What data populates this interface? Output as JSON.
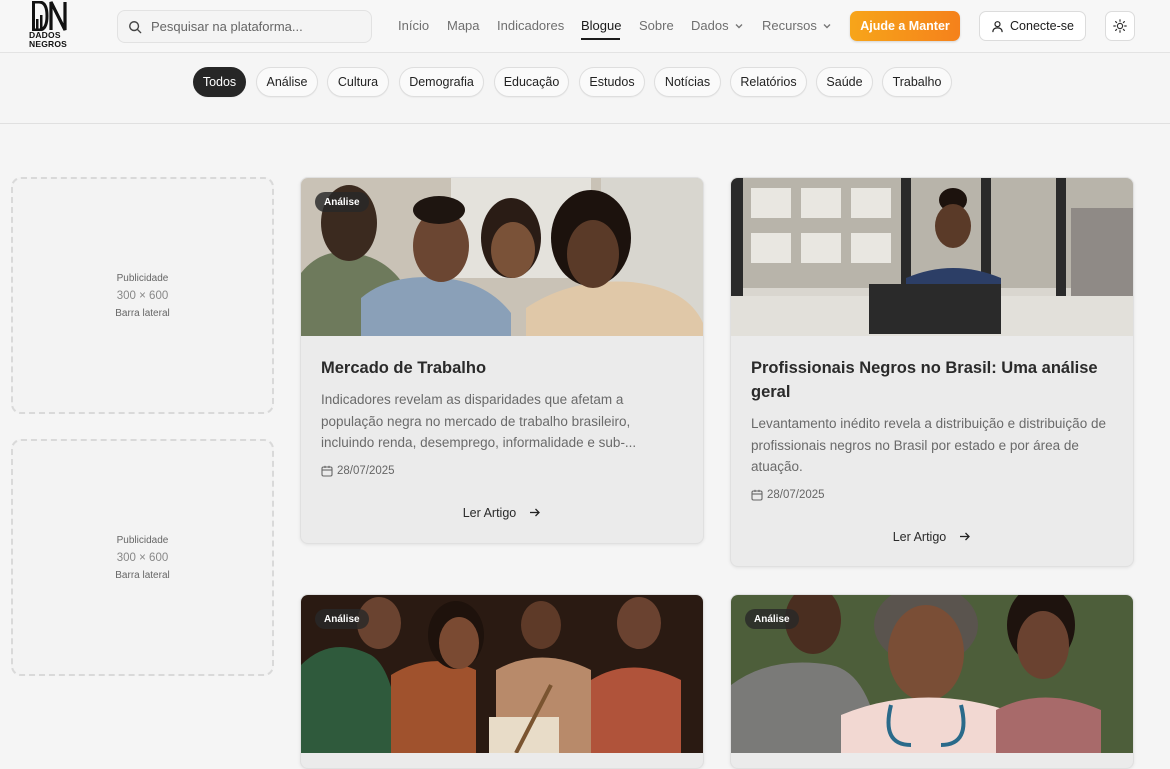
{
  "brand": {
    "line1": "DADOS",
    "line2": "NEGROS"
  },
  "search": {
    "placeholder": "Pesquisar na plataforma..."
  },
  "nav": {
    "inicio": "Início",
    "mapa": "Mapa",
    "indicadores": "Indicadores",
    "blogue": "Blogue",
    "sobre": "Sobre",
    "dados": "Dados",
    "recursos": "Recursos"
  },
  "actions": {
    "support": "Ajude a Manter",
    "connect": "Conecte-se"
  },
  "filters": [
    "Todos",
    "Análise",
    "Cultura",
    "Demografia",
    "Educação",
    "Estudos",
    "Notícias",
    "Relatórios",
    "Saúde",
    "Trabalho"
  ],
  "active_filter": "Todos",
  "ads": [
    {
      "label": "Publicidade",
      "size": "300 × 600",
      "position": "Barra lateral"
    },
    {
      "label": "Publicidade",
      "size": "300 × 600",
      "position": "Barra lateral"
    }
  ],
  "articles": [
    {
      "badge": "Análise",
      "title": "Mercado de Trabalho",
      "description": "Indicadores revelam as disparidades que afetam a população negra no mercado de trabalho brasileiro, incluindo renda, desemprego, informalidade e sub-...",
      "date": "28/07/2025",
      "link": "Ler Artigo"
    },
    {
      "badge": "",
      "title": "Profissionais Negros no Brasil: Uma análise geral",
      "description": "Levantamento inédito revela a distribuição e distribuição de profissionais negros no Brasil por estado e por área de atuação.",
      "date": "28/07/2025",
      "link": "Ler Artigo"
    },
    {
      "badge": "Análise"
    },
    {
      "badge": "Análise"
    }
  ],
  "colors": {
    "accent_start": "#f7a51a",
    "accent_end": "#f5811b",
    "chip_active": "#262626"
  }
}
